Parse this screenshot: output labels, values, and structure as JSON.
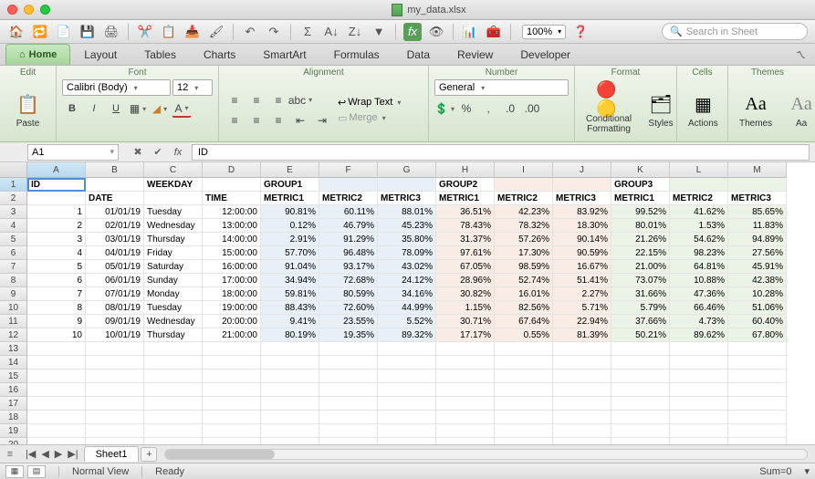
{
  "window": {
    "title": "my_data.xlsx"
  },
  "search": {
    "placeholder": "Search in Sheet"
  },
  "zoom": {
    "value": "100%"
  },
  "tabs": [
    "Home",
    "Layout",
    "Tables",
    "Charts",
    "SmartArt",
    "Formulas",
    "Data",
    "Review",
    "Developer"
  ],
  "ribbon": {
    "groups": [
      "Edit",
      "Font",
      "Alignment",
      "Number",
      "Format",
      "Cells",
      "Themes"
    ],
    "paste": "Paste",
    "font_name": "Calibri (Body)",
    "font_size": "12",
    "wrap": "Wrap Text",
    "merge": "Merge",
    "number_format": "General",
    "cond": "Conditional Formatting",
    "styles": "Styles",
    "actions": "Actions",
    "themes": "Themes",
    "aa": "Aa"
  },
  "namebox": "A1",
  "formula": "ID",
  "columns": [
    "A",
    "B",
    "C",
    "D",
    "E",
    "F",
    "G",
    "H",
    "I",
    "J",
    "K",
    "L",
    "M"
  ],
  "headers_row1": {
    "A": "ID",
    "C": "WEEKDAY",
    "E": "GROUP1",
    "H": "GROUP2",
    "K": "GROUP3"
  },
  "headers_row2": {
    "B": "DATE",
    "D": "TIME",
    "E": "METRIC1",
    "F": "METRIC2",
    "G": "METRIC3",
    "H": "METRIC1",
    "I": "METRIC2",
    "J": "METRIC3",
    "K": "METRIC1",
    "L": "METRIC2",
    "M": "METRIC3"
  },
  "rows": [
    {
      "id": "1",
      "date": "01/01/19",
      "wd": "Tuesday",
      "time": "12:00:00",
      "g1": [
        "90.81%",
        "60.11%",
        "88.01%"
      ],
      "g2": [
        "36.51%",
        "42.23%",
        "83.92%"
      ],
      "g3": [
        "99.52%",
        "41.62%",
        "85.65%"
      ]
    },
    {
      "id": "2",
      "date": "02/01/19",
      "wd": "Wednesday",
      "time": "13:00:00",
      "g1": [
        "0.12%",
        "46.79%",
        "45.23%"
      ],
      "g2": [
        "78.43%",
        "78.32%",
        "18.30%"
      ],
      "g3": [
        "80.01%",
        "1.53%",
        "11.83%"
      ]
    },
    {
      "id": "3",
      "date": "03/01/19",
      "wd": "Thursday",
      "time": "14:00:00",
      "g1": [
        "2.91%",
        "91.29%",
        "35.80%"
      ],
      "g2": [
        "31.37%",
        "57.26%",
        "90.14%"
      ],
      "g3": [
        "21.26%",
        "54.62%",
        "94.89%"
      ]
    },
    {
      "id": "4",
      "date": "04/01/19",
      "wd": "Friday",
      "time": "15:00:00",
      "g1": [
        "57.70%",
        "96.48%",
        "78.09%"
      ],
      "g2": [
        "97.61%",
        "17.30%",
        "90.59%"
      ],
      "g3": [
        "22.15%",
        "98.23%",
        "27.56%"
      ]
    },
    {
      "id": "5",
      "date": "05/01/19",
      "wd": "Saturday",
      "time": "16:00:00",
      "g1": [
        "91.04%",
        "93.17%",
        "43.02%"
      ],
      "g2": [
        "67.05%",
        "98.59%",
        "16.67%"
      ],
      "g3": [
        "21.00%",
        "64.81%",
        "45.91%"
      ]
    },
    {
      "id": "6",
      "date": "06/01/19",
      "wd": "Sunday",
      "time": "17:00:00",
      "g1": [
        "34.94%",
        "72.68%",
        "24.12%"
      ],
      "g2": [
        "28.96%",
        "52.74%",
        "51.41%"
      ],
      "g3": [
        "73.07%",
        "10.88%",
        "42.38%"
      ]
    },
    {
      "id": "7",
      "date": "07/01/19",
      "wd": "Monday",
      "time": "18:00:00",
      "g1": [
        "59.81%",
        "80.59%",
        "34.16%"
      ],
      "g2": [
        "30.82%",
        "16.01%",
        "2.27%"
      ],
      "g3": [
        "31.66%",
        "47.36%",
        "10.28%"
      ]
    },
    {
      "id": "8",
      "date": "08/01/19",
      "wd": "Tuesday",
      "time": "19:00:00",
      "g1": [
        "88.43%",
        "72.60%",
        "44.99%"
      ],
      "g2": [
        "1.15%",
        "82.56%",
        "5.71%"
      ],
      "g3": [
        "5.79%",
        "66.46%",
        "51.06%"
      ]
    },
    {
      "id": "9",
      "date": "09/01/19",
      "wd": "Wednesday",
      "time": "20:00:00",
      "g1": [
        "9.41%",
        "23.55%",
        "5.52%"
      ],
      "g2": [
        "30.71%",
        "67.64%",
        "22.94%"
      ],
      "g3": [
        "37.66%",
        "4.73%",
        "60.40%"
      ]
    },
    {
      "id": "10",
      "date": "10/01/19",
      "wd": "Thursday",
      "time": "21:00:00",
      "g1": [
        "80.19%",
        "19.35%",
        "89.32%"
      ],
      "g2": [
        "17.17%",
        "0.55%",
        "81.39%"
      ],
      "g3": [
        "50.21%",
        "89.62%",
        "67.80%"
      ]
    }
  ],
  "sheet": {
    "name": "Sheet1"
  },
  "status": {
    "view": "Normal View",
    "ready": "Ready",
    "sum": "Sum=0"
  }
}
